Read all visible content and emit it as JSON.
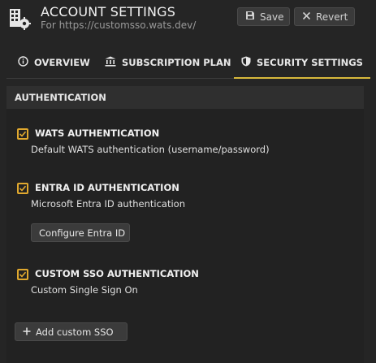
{
  "header": {
    "title": "ACCOUNT SETTINGS",
    "subtitle": "For https://customsso.wats.dev/",
    "app_icon": "building-gear-icon",
    "save_label": "Save",
    "save_icon": "floppy-disk-icon",
    "revert_label": "Revert",
    "revert_icon": "close-icon"
  },
  "tabs": [
    {
      "label": "OVERVIEW",
      "icon": "info-circle-icon",
      "active": false
    },
    {
      "label": "SUBSCRIPTION PLAN",
      "icon": "bank-icon",
      "active": false
    },
    {
      "label": "SECURITY SETTINGS",
      "icon": "shield-icon",
      "active": true
    }
  ],
  "section": {
    "title": "AUTHENTICATION"
  },
  "auth_options": [
    {
      "title": "WATS AUTHENTICATION",
      "description": "Default WATS authentication (username/password)",
      "checked": true
    },
    {
      "title": "ENTRA ID AUTHENTICATION",
      "description": "Microsoft Entra ID authentication",
      "checked": true,
      "button_label": "Configure Entra ID"
    },
    {
      "title": "CUSTOM SSO AUTHENTICATION",
      "description": "Custom Single Sign On",
      "checked": true
    }
  ],
  "add_sso": {
    "label": "Add custom SSO",
    "icon": "plus-icon"
  },
  "colors": {
    "accent": "#d8b93c",
    "checkbox": "#e0a82e",
    "background": "#252525"
  }
}
